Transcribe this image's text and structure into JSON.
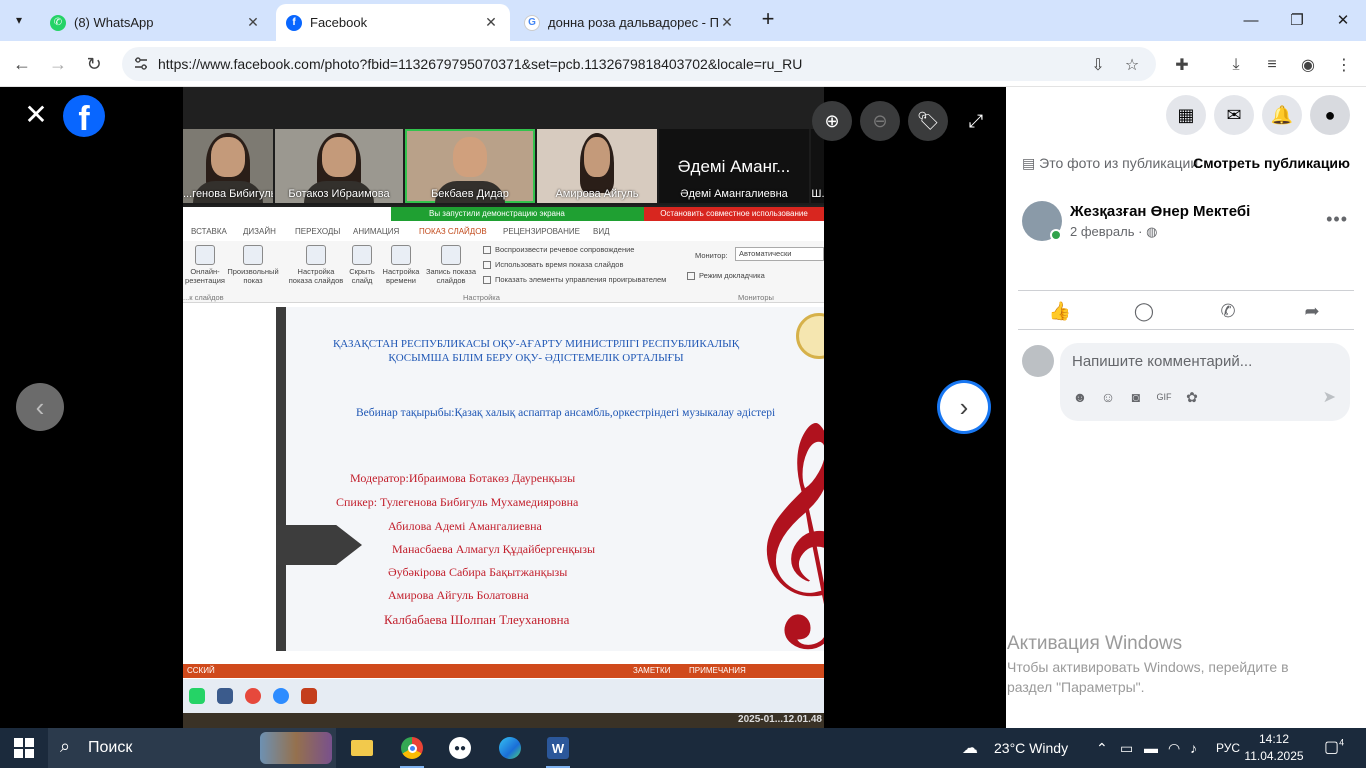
{
  "browser": {
    "tabs": [
      {
        "title": "(8) WhatsApp",
        "favicon_color": "#25d366"
      },
      {
        "title": "Facebook",
        "favicon_color": "#0866ff"
      },
      {
        "title": "донна роза дальвадорес - Пои",
        "favicon_color": "#4285f4"
      }
    ],
    "url": "https://www.facebook.com/photo?fbid=1132679795070371&set=pcb.1132679818403702&locale=ru_RU"
  },
  "viewer": {
    "screen_video_names": [
      "...генова Бибигуль",
      "Ботакоз Ибраимова",
      "Бекбаев Дидар",
      "Амирова Айгуль",
      "Әдемі Амангалиевна",
      "Ш..."
    ],
    "big_tile_text": "Әдемі Аманг...",
    "share_notice": "Вы запустили демонстрацию экрана",
    "share_stop": "Остановить совместное использование",
    "ribbon_tabs": [
      "ВСТАВКА",
      "ДИЗАЙН",
      "ПЕРЕХОДЫ",
      "АНИМАЦИЯ",
      "ПОКАЗ СЛАЙДОВ",
      "РЕЦЕНЗИРОВАНИЕ",
      "ВИД"
    ],
    "ribbon_buttons": [
      "Онлайн-\nрезентация",
      "Произвольный\nпоказ",
      "Настройка\nпоказа слайдов",
      "Скрыть\nслайд",
      "Настройка\nвремени",
      "Запись показа\nслайдов"
    ],
    "ribbon_checks": [
      "Воспроизвести речевое сопровождение",
      "Использовать время показа слайдов",
      "Показать элементы управления проигрывателем"
    ],
    "monitor_label": "Монитор:",
    "monitor_value": "Автоматически",
    "presenter_mode": "Режим докладчика",
    "group_labels": [
      "...к слайдов",
      "Настройка",
      "Мониторы"
    ],
    "slide_title": "ҚАЗАҚСТАН РЕСПУБЛИКАСЫ ОҚУ-АҒАРТУ МИНИСТРЛІГІ РЕСПУБЛИКАЛЫҚ ҚОСЫМША БІЛІМ БЕРУ ОҚУ- ӘДІСТЕМЕЛІК ОРТАЛЫҒЫ",
    "slide_topic": "Вебинар тақырыбы:Қазақ халық аспаптар ансамбль,оркестріндегі музыкалау әдістері",
    "slide_lines": [
      "Модератор:Ибраимова Ботакөз Дауренқызы",
      "Спикер: Тулегенова Бибигуль Мухамедияровна",
      "Абилова Адемі Амангалиевна",
      "Манасбаева Алмагул Құдайбергенқызы",
      "Әубәкірова Сабира Бақытжанқызы",
      "Амирова  Айгуль Болатовна",
      "Калбабаева Шолпан Тлеухановна"
    ],
    "status_left": "ССКИЙ",
    "status_notes": "ЗАМЕТКИ",
    "status_comments": "ПРИМЕЧАНИЯ",
    "timestamp": "2025-01...12.01.48"
  },
  "panel": {
    "from_post": "Это фото из публикации.",
    "see_post": "Смотреть публикацию",
    "author": "Жезқазған Өнер Мектебі",
    "date": "2 февраль ·",
    "comment_placeholder": "Напишите комментарий..."
  },
  "windows_activation": {
    "title": "Активация Windows",
    "text": "Чтобы активировать Windows, перейдите в раздел \"Параметры\"."
  },
  "taskbar": {
    "search": "Поиск",
    "weather": "23°C  Windy",
    "lang": "РУС",
    "time": "14:12",
    "date": "11.04.2025",
    "notifications": "4"
  }
}
